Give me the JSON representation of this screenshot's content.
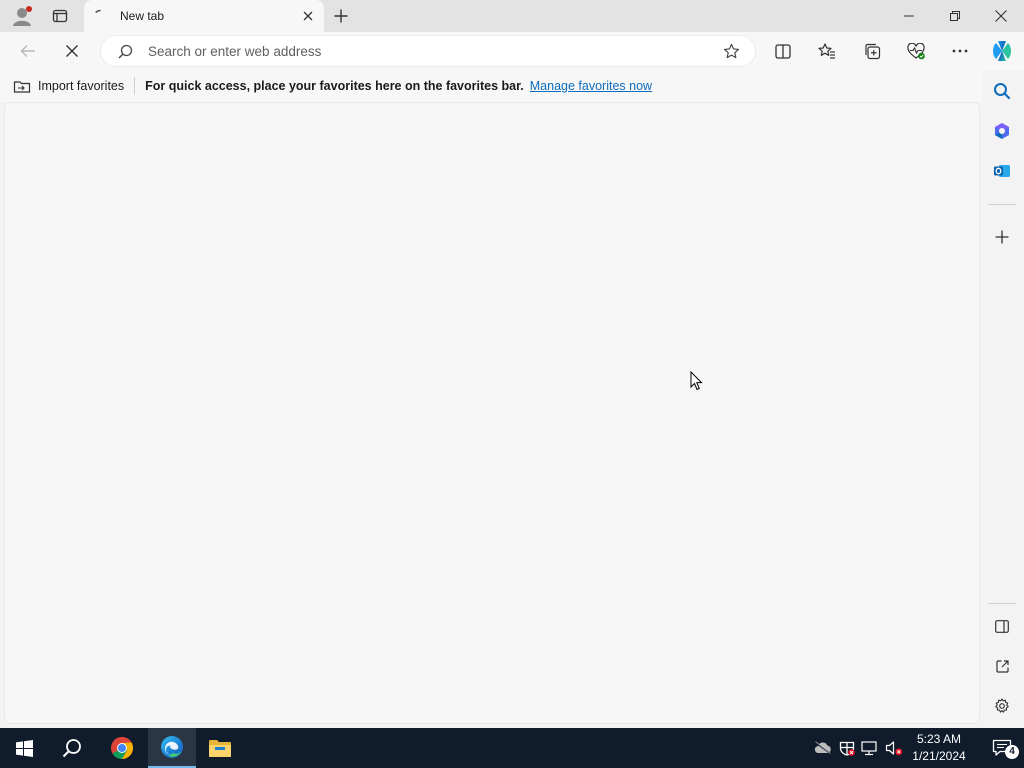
{
  "tab": {
    "title": "New tab"
  },
  "address_bar": {
    "placeholder": "Search or enter web address",
    "value": ""
  },
  "favorites_bar": {
    "import_label": "Import favorites",
    "message": "For quick access, place your favorites here on the favorites bar.",
    "link_label": "Manage favorites now"
  },
  "taskbar": {
    "time": "5:23 AM",
    "date": "1/21/2024",
    "notification_count": "4"
  },
  "colors": {
    "accent_link": "#0f6cbd",
    "taskbar_bg": "#101c2c",
    "tab_bar_bg": "#e3e3e3",
    "page_bg": "#f7f7f7"
  }
}
